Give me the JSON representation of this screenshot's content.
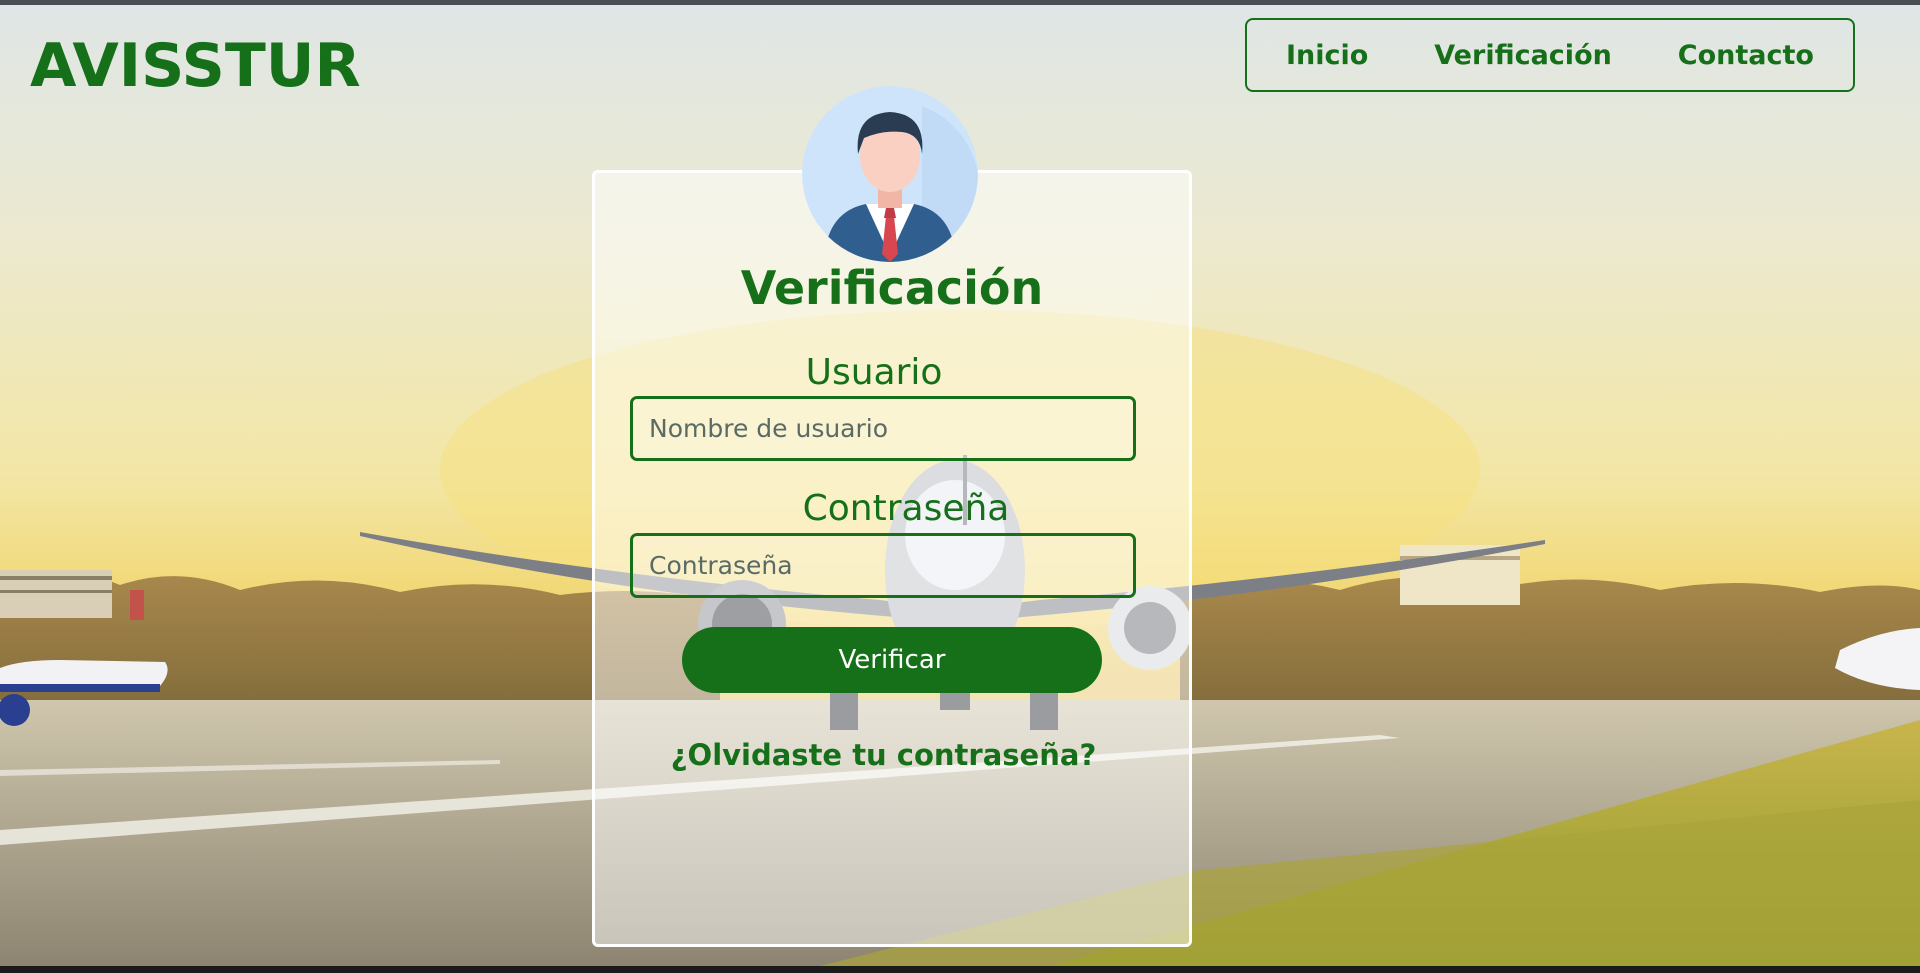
{
  "header": {
    "brand": "AVISSTUR",
    "nav": {
      "home": "Inicio",
      "verification": "Verificación",
      "contact": "Contacto"
    }
  },
  "form": {
    "title": "Verificación",
    "username_label": "Usuario",
    "username_placeholder": "Nombre de usuario",
    "username_value": "",
    "password_label": "Contraseña",
    "password_placeholder": "Contraseña",
    "password_value": "",
    "submit_label": "Verificar",
    "forgot_link": "¿Olvidaste tu contraseña?"
  },
  "icons": {
    "avatar": "user-avatar-icon"
  },
  "colors": {
    "brand_green": "#16701a",
    "button_text": "#ffffff",
    "card_border": "#ffffff"
  }
}
